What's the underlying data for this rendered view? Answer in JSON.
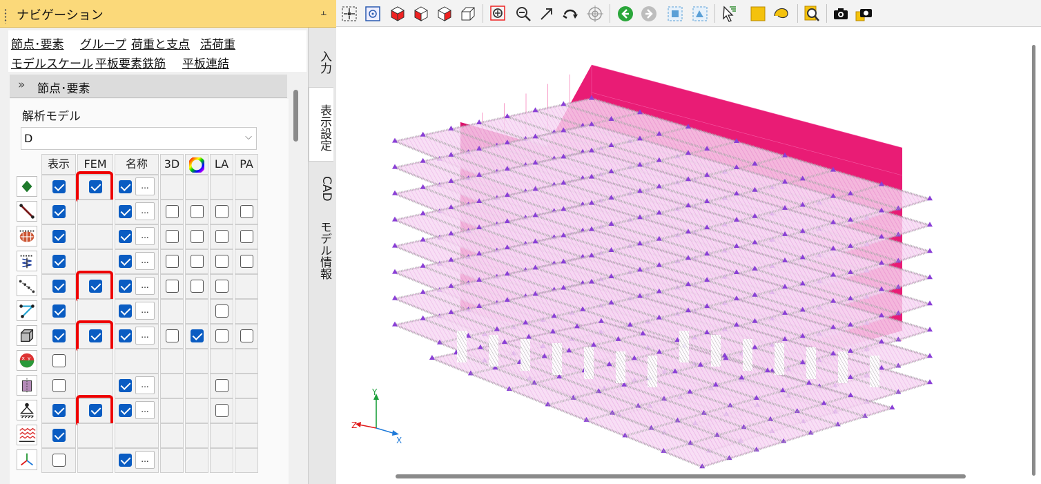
{
  "nav": {
    "title": "ナビゲーション",
    "pin_icon": "pin-icon",
    "links": [
      "節点･要素",
      "グループ",
      "荷重と支点",
      "活荷重",
      "モデルスケール",
      "平板要素鉄筋",
      "平板連結"
    ],
    "section_title": "節点･要素",
    "model_label": "解析モデル",
    "model_value": "D",
    "columns": [
      "表示",
      "FEM",
      "名称",
      "3D",
      "",
      "LA",
      "PA"
    ],
    "rows": [
      {
        "icon": "node-icon",
        "show": true,
        "fem": true,
        "name": true,
        "d3": null,
        "color": null,
        "la": null,
        "pa": null
      },
      {
        "icon": "beam-element-icon",
        "show": true,
        "fem": null,
        "name": true,
        "d3": false,
        "color": false,
        "la": false,
        "pa": false
      },
      {
        "icon": "truss-element-icon",
        "show": true,
        "fem": null,
        "name": true,
        "d3": false,
        "color": false,
        "la": false,
        "pa": false
      },
      {
        "icon": "spring-element-icon",
        "show": true,
        "fem": null,
        "name": true,
        "d3": false,
        "color": false,
        "la": false,
        "pa": false
      },
      {
        "icon": "line-element-icon",
        "show": true,
        "fem": true,
        "name": true,
        "d3": false,
        "color": false,
        "la": false,
        "pa": null
      },
      {
        "icon": "link-element-icon",
        "show": true,
        "fem": null,
        "name": true,
        "d3": null,
        "color": null,
        "la": false,
        "pa": null
      },
      {
        "icon": "solid-element-icon",
        "show": true,
        "fem": true,
        "name": true,
        "d3": false,
        "color": true,
        "la": false,
        "pa": false
      },
      {
        "icon": "local-axis-icon",
        "show": false,
        "fem": null,
        "name": null,
        "d3": null,
        "color": null,
        "la": null,
        "pa": null
      },
      {
        "icon": "rigid-element-icon",
        "show": false,
        "fem": null,
        "name": true,
        "d3": null,
        "color": null,
        "la": false,
        "pa": null
      },
      {
        "icon": "support-icon",
        "show": true,
        "fem": true,
        "name": true,
        "d3": null,
        "color": null,
        "la": false,
        "pa": null
      },
      {
        "icon": "ground-spring-icon",
        "show": true,
        "fem": null,
        "name": null,
        "d3": null,
        "color": null,
        "la": null,
        "pa": null
      },
      {
        "icon": "coordinate-axis-icon",
        "show": false,
        "fem": null,
        "name": true,
        "d3": null,
        "color": null,
        "la": null,
        "pa": null
      }
    ]
  },
  "tabs": [
    "入力",
    "表示設定",
    "CAD",
    "モデル情報"
  ],
  "toolbar": {
    "icons": [
      "fit-view-icon",
      "zoom-window-icon",
      "iso-view-icon",
      "front-view-icon",
      "side-view-icon",
      "wireframe-view-icon",
      "zoom-area-icon",
      "zoom-out-icon",
      "pan-icon",
      "rotate-icon",
      "target-icon",
      "back-arrow-icon",
      "forward-arrow-icon",
      "select-node-icon",
      "select-element-icon",
      "pointer-icon",
      "select-box-icon",
      "lasso-icon",
      "find-icon",
      "camera-icon",
      "camera-save-icon"
    ]
  },
  "viewport": {
    "axes": {
      "x": "X",
      "y": "Y",
      "z": "Z"
    },
    "colors": {
      "wall": "#e8136f",
      "slab": "#f1c0ec",
      "spring": "#a9a9a9",
      "node": "#8a3fd6",
      "axis_x": "#1f7ad9",
      "axis_y": "#1a9e3a",
      "axis_z": "#e01a1a"
    }
  }
}
